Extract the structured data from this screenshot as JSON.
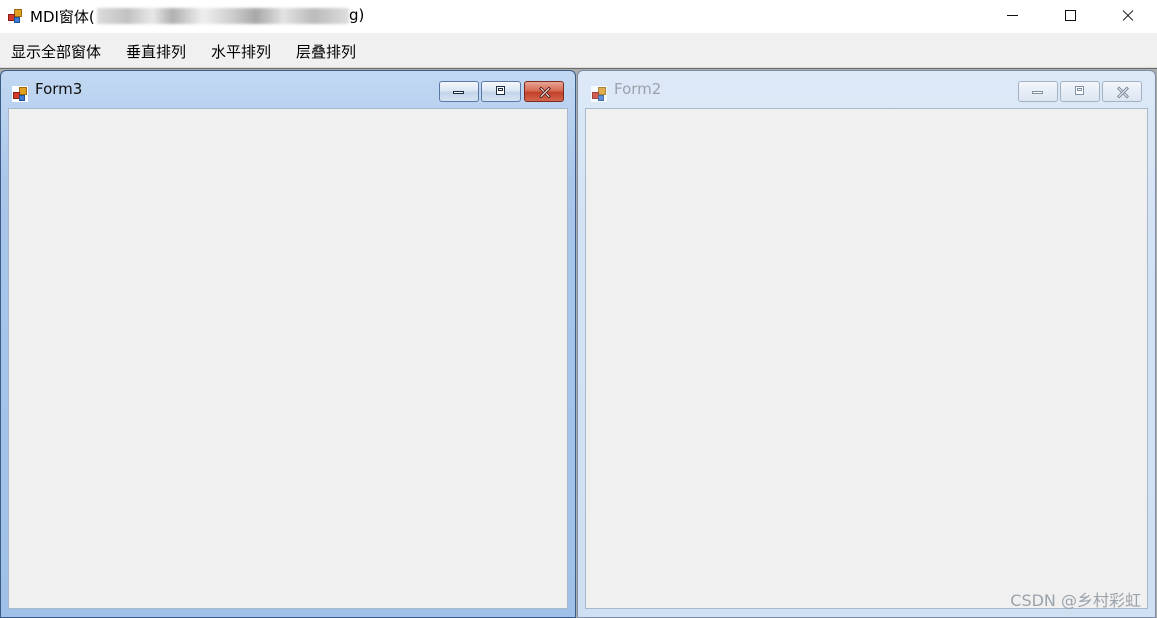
{
  "window": {
    "title_prefix": "MDI窗体(",
    "title_suffix": "g)",
    "minimize_icon": "minimize-icon",
    "maximize_icon": "maximize-icon",
    "close_icon": "close-icon"
  },
  "menu": {
    "items": [
      {
        "label": "显示全部窗体"
      },
      {
        "label": "垂直排列"
      },
      {
        "label": "水平排列"
      },
      {
        "label": "层叠排列"
      }
    ]
  },
  "children": [
    {
      "title": "Form3",
      "state": "active"
    },
    {
      "title": "Form2",
      "state": "inactive"
    }
  ],
  "watermark": "CSDN @乡村彩虹",
  "colors": {
    "active_close": "#c3402a",
    "active_frame": "#9fc0e8",
    "inactive_frame": "#cfe0f3",
    "client": "#f0f0f0"
  }
}
